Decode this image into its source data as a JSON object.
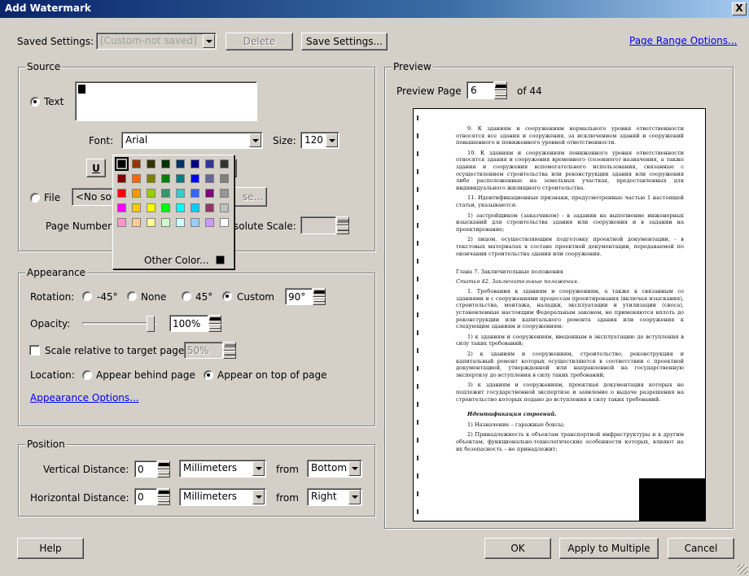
{
  "window": {
    "title": "Add Watermark",
    "close_label": "X"
  },
  "header": {
    "saved_settings_label": "Saved Settings:",
    "saved_settings_value": "[Custom-not saved]",
    "delete_label": "Delete",
    "save_settings_label": "Save Settings...",
    "page_range_link": "Page Range Options..."
  },
  "source": {
    "title": "Source",
    "text_option": "Text",
    "file_option": "File",
    "file_value": "<No sou",
    "browse_label": "se...",
    "font_label": "Font:",
    "font_value": "Arial",
    "size_label": "Size:",
    "size_value": "120",
    "underline_label": "U",
    "page_number_label": "Page Number:",
    "abs_scale_label": "solute Scale:",
    "text_color": "#000000"
  },
  "color_popup": {
    "other_color_label": "Other Color...",
    "rows": [
      [
        "#000000",
        "#993300",
        "#333300",
        "#003300",
        "#003366",
        "#000080",
        "#333399",
        "#333333"
      ],
      [
        "#800000",
        "#ff6600",
        "#808000",
        "#008000",
        "#008080",
        "#0000ff",
        "#666699",
        "#808080"
      ],
      [
        "#ff0000",
        "#ff9900",
        "#99cc00",
        "#339966",
        "#33cccc",
        "#3366ff",
        "#800080",
        "#969696"
      ],
      [
        "#ff00ff",
        "#ffcc00",
        "#ffff00",
        "#00ff00",
        "#00ffff",
        "#00ccff",
        "#993366",
        "#c0c0c0"
      ],
      [
        "#ff99cc",
        "#ffcc99",
        "#ffff99",
        "#ccffcc",
        "#ccffff",
        "#99ccff",
        "#cc99ff",
        "#ffffff"
      ]
    ]
  },
  "appearance": {
    "title": "Appearance",
    "rotation_label": "Rotation:",
    "rot_m45": "-45°",
    "rot_none": "None",
    "rot_45": "45°",
    "rot_custom": "Custom",
    "rot_value": "90°",
    "opacity_label": "Opacity:",
    "opacity_value": "100%",
    "opacity_level": 1.0,
    "scale_label": "Scale relative to target page",
    "scale_value": "50%",
    "location_label": "Location:",
    "behind_label": "Appear behind page",
    "top_label": "Appear on top of page",
    "options_link": "Appearance Options..."
  },
  "position": {
    "title": "Position",
    "vert_label": "Vertical Distance:",
    "vert_value": "0",
    "vert_unit": "Millimeters",
    "from1": "from",
    "vert_from": "Bottom",
    "horiz_label": "Horizontal Distance:",
    "horiz_value": "0",
    "horiz_unit": "Millimeters",
    "from2": "from",
    "horiz_from": "Right"
  },
  "preview": {
    "title": "Preview",
    "page_label": "Preview Page",
    "page_value": "6",
    "of_label": "of 44",
    "doc": {
      "p1": "9. К зданиям и сооружениям нормального уровня ответственности относятся все здания и сооружения, за исключением зданий и сооружений повышенного и пониженного уровней ответственности.",
      "p2": "10. К зданиям и сооружениям пониженного уровня ответственности относятся здания и сооружения временного (сезонного) назначения, а также здания и сооружения вспомогательного использования, связанные с осуществлением строительства или реконструкции здания или сооружения либо расположенные на земельных участках, предоставленных для индивидуального жилищного строительства.",
      "p3": "11. Идентификационные признаки, предусмотренные частью 1 настоящей статьи, указываются:",
      "p4": "1) застройщиком (заказчиком) - в задании на выполнение инженерных изысканий для строительства здания или сооружения и в задании на проектирование;",
      "p5": "2) лицом, осуществляющим подготовку проектной документации, - в текстовых материалах в составе проектной документации, передаваемой по окончании строительства здания или сооружения.",
      "h1": "Глава 7. Заключительные положения",
      "h2": "Статья 42. Заключительные положения.",
      "p6": "1. Требования к зданиям и сооружениям, а также к связанным со зданиями и с сооружениями процессам проектирования (включая изыскания), строительства, монтажа, наладки, эксплуатации и утилизации (сноса), установленные настоящим Федеральным законом, не применяются вплоть до реконструкции или капитального ремонта здания или сооружения к следующим зданиям и сооружениям:",
      "p7": "1) к зданиям и сооружениям, введенным в эксплуатацию до вступления в силу таких требований;",
      "p8": "2) к зданиям и сооружениям, строительство, реконструкция и капитальный ремонт которых осуществляются в соответствии с проектной документацией, утвержденной или направленной на государственную экспертизу до вступления в силу таких требований;",
      "p9": "3) к зданиям и сооружениям, проектная документация которых не подлежит государственной экспертизе и заявление о выдаче разрешения на строительство которых подано до вступления в силу таких требований.",
      "h3": "Идентификация строений.",
      "p10": "1) Назначение – гаражные боксы;",
      "p11": "2) Принадлежность к объектам транспортной инфраструктуры и к другим объектам, функционально-технологические особенности которых, влияют на их безопасность – не принадлежит;"
    }
  },
  "footer": {
    "help_label": "Help",
    "ok_label": "OK",
    "apply_multiple_label": "Apply to Multiple",
    "cancel_label": "Cancel"
  }
}
